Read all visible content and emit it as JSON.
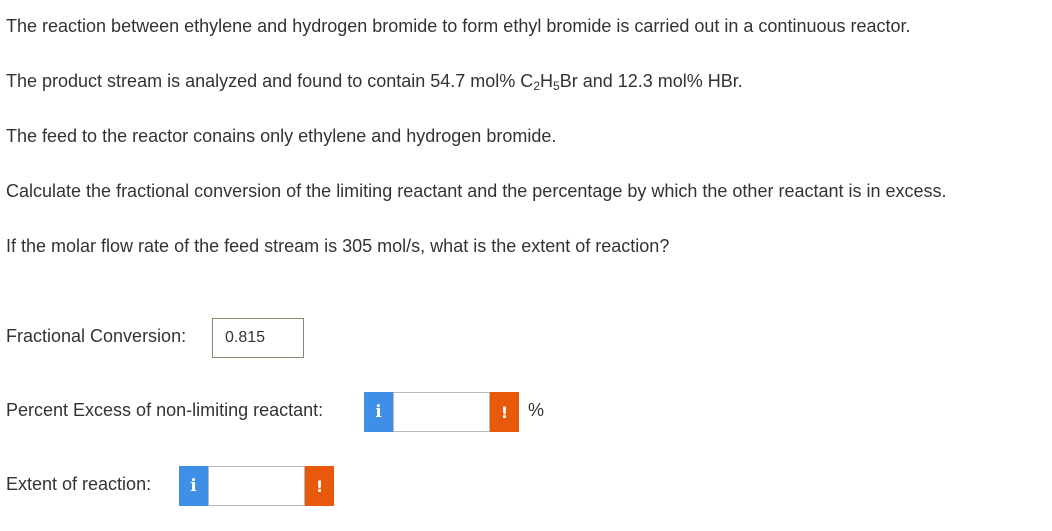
{
  "problem": {
    "p1": "The reaction between ethylene and hydrogen bromide to form ethyl bromide is carried out in a continuous reactor.",
    "p2_before": "The product stream is analyzed and found to contain 54.7 mol% C",
    "p2_sub1": "2",
    "p2_mid1": "H",
    "p2_sub2": "5",
    "p2_after": "Br and 12.3 mol% HBr.",
    "p3": "The feed to the reactor conains only ethylene and hydrogen bromide.",
    "p4": "Calculate the fractional conversion of the limiting reactant and the percentage by which the other reactant is in excess.",
    "p5": "If the molar flow rate of the feed stream is 305 mol/s, what is the extent of reaction?"
  },
  "answers": {
    "fractional_conversion": {
      "label": "Fractional Conversion:",
      "value": "0.815"
    },
    "percent_excess": {
      "label": "Percent Excess of non-limiting reactant:",
      "value": "",
      "info_icon": "i",
      "warning_icon": "!",
      "unit": "%"
    },
    "extent_of_reaction": {
      "label": "Extent of reaction:",
      "value": "",
      "info_icon": "i",
      "warning_icon": "!"
    }
  },
  "colors": {
    "info": "#3f8fe6",
    "warning": "#e8590c",
    "text": "#333333"
  }
}
